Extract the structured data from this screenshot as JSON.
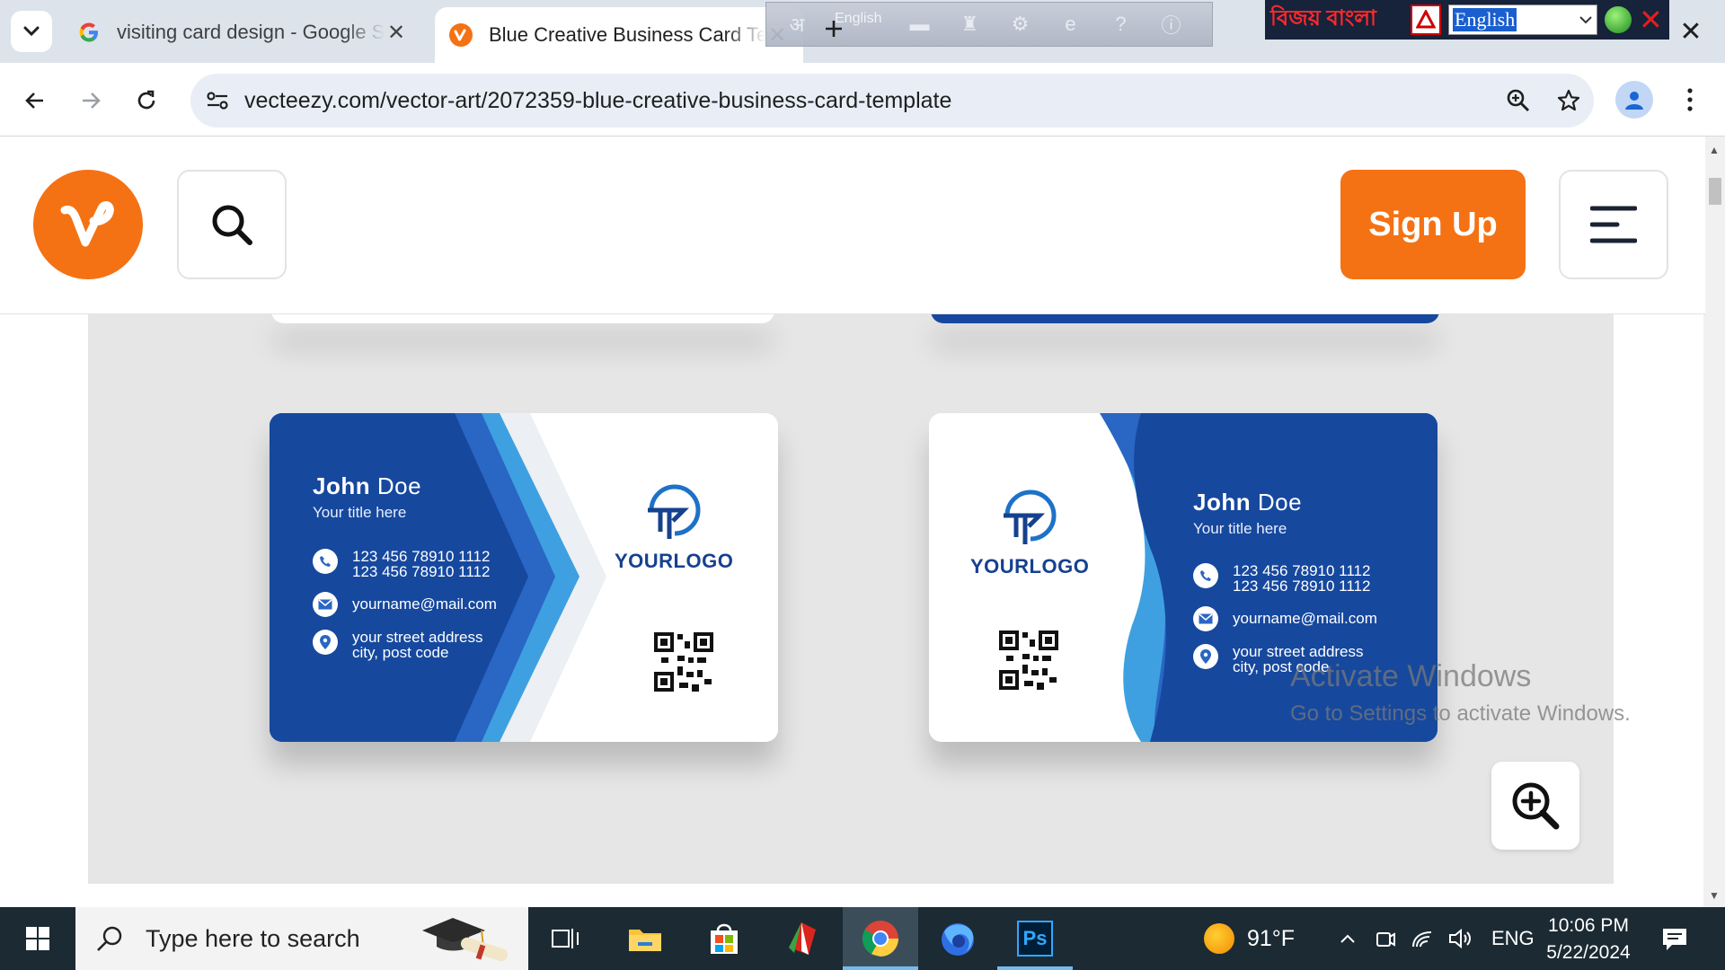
{
  "browser": {
    "tabs": [
      {
        "title": "visiting card design - Google Se",
        "favicon": "google-icon",
        "active": false
      },
      {
        "title": "Blue Creative Business Card Ten",
        "favicon": "vecteezy-icon",
        "active": true
      }
    ],
    "lang_overlay": {
      "label": "English"
    },
    "bangla_toolbar": {
      "app_text": "বিজয় বাংলা",
      "language_value": "English"
    },
    "url": "vecteezy.com/vector-art/2072359-blue-creative-business-card-template"
  },
  "site": {
    "name": "Vecteezy",
    "logo_letter": "v",
    "signup_label": "Sign Up",
    "brand_color": "#f47214"
  },
  "cards": {
    "left": {
      "first_name": "John",
      "last_name": "Doe",
      "job_title": "Your title here",
      "phone_1": "123 456 78910 1112",
      "phone_2": "123 456 78910 1112",
      "email": "yourname@mail.com",
      "address_1": "your street address",
      "address_2": "city, post code",
      "logo_text": "YOURLOGO"
    },
    "right": {
      "first_name": "John",
      "last_name": "Doe",
      "job_title": "Your title here",
      "phone_1": "123 456 78910 1112",
      "phone_2": "123 456 78910 1112",
      "email": "yourname@mail.com",
      "address_1": "your street address",
      "address_2": "city, post code",
      "logo_text": "YOURLOGO"
    },
    "colors": {
      "navy": "#16489e",
      "mid_blue": "#2a66c4",
      "light_blue": "#3ea0e0"
    }
  },
  "watermark": {
    "line1": "Activate Windows",
    "line2": "Go to Settings to activate Windows."
  },
  "taskbar": {
    "search_placeholder": "Type here to search",
    "apps": [
      "task-view",
      "file-explorer",
      "microsoft-store",
      "office",
      "chrome",
      "firefox",
      "photoshop"
    ],
    "photoshop_label": "Ps",
    "temperature": "91°F",
    "language": "ENG",
    "time": "10:06 PM",
    "date": "5/22/2024"
  }
}
